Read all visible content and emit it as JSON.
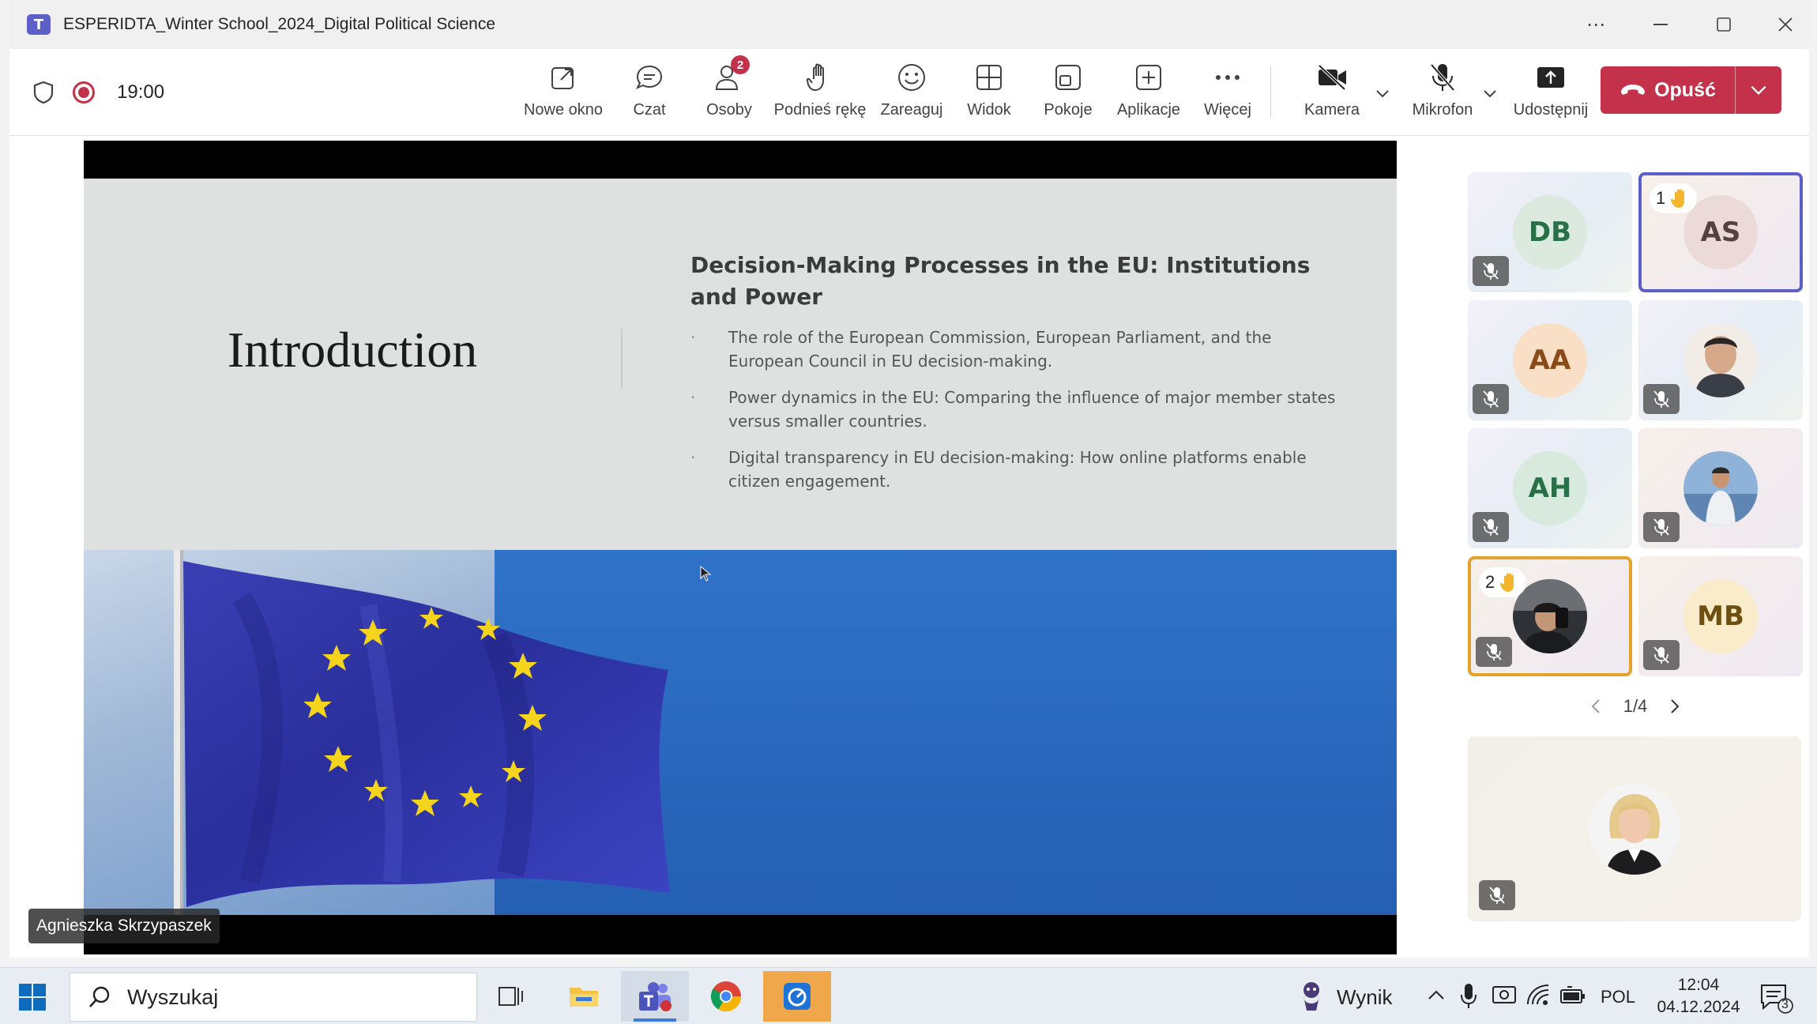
{
  "window": {
    "title": "ESPERIDTA_Winter School_2024_Digital Political Science"
  },
  "toolbar": {
    "timer": "19:00",
    "buttons": {
      "new_window": "Nowe okno",
      "chat": "Czat",
      "people": "Osoby",
      "people_count": "2",
      "raise_hand": "Podnieś rękę",
      "react": "Zareaguj",
      "view": "Widok",
      "rooms": "Pokoje",
      "apps": "Aplikacje",
      "more": "Więcej",
      "camera": "Kamera",
      "mic": "Mikrofon",
      "share": "Udostępnij"
    },
    "leave_label": "Opuść",
    "accent_leave": "#c4314b"
  },
  "slide": {
    "title": "Introduction",
    "heading": "Decision-Making Processes in the EU: Institutions and Power",
    "bullets": [
      "The role of the European Commission, European Parliament, and the European Council in EU decision-making.",
      "Power dynamics in the EU: Comparing the influence of major member states versus smaller countries.",
      "Digital transparency in EU decision-making: How online platforms enable citizen engagement."
    ]
  },
  "presenter": {
    "name": "Agnieszka Skrzypaszek"
  },
  "participants": [
    {
      "initials": "DB",
      "type": "initials"
    },
    {
      "initials": "AS",
      "type": "initials",
      "hand_order": "1",
      "selected": true
    },
    {
      "initials": "AA",
      "type": "initials"
    },
    {
      "type": "photo"
    },
    {
      "initials": "AH",
      "type": "initials"
    },
    {
      "type": "photo"
    },
    {
      "type": "photo",
      "hand_order": "2"
    },
    {
      "initials": "MB",
      "type": "initials"
    }
  ],
  "pager": {
    "label": "1/4"
  },
  "taskbar": {
    "search_placeholder": "Wyszukaj",
    "weather_label": "Wynik",
    "language": "POL",
    "time": "12:04",
    "date": "04.12.2024",
    "notification_count": "3"
  }
}
